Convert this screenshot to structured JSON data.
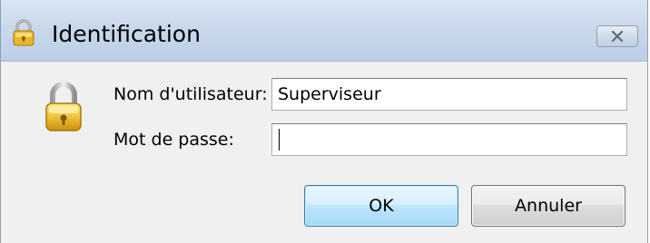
{
  "window": {
    "title": "Identification",
    "title_icon": "padlock-icon",
    "close_icon": "close-icon"
  },
  "form": {
    "lock_icon": "padlock-icon",
    "username_label": "Nom d'utilisateur:",
    "username_value": "Superviseur",
    "password_label": "Mot de passe:",
    "password_value": ""
  },
  "buttons": {
    "ok_label": "OK",
    "cancel_label": "Annuler"
  },
  "colors": {
    "titlebar": "#c9d8ec",
    "client_background": "#f0f0f0",
    "default_button_border": "#3c7fb1"
  }
}
